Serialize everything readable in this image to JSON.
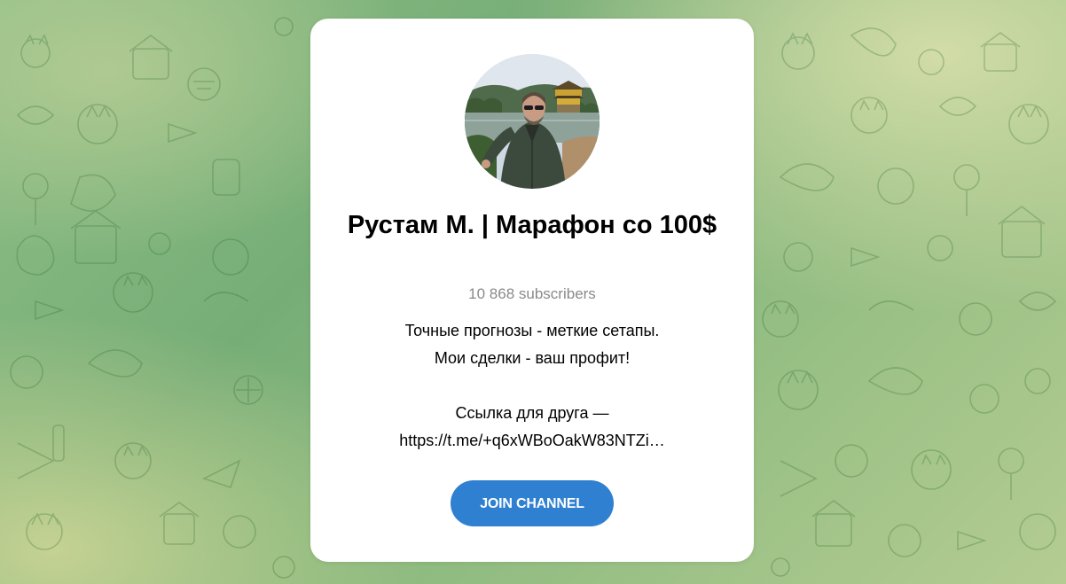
{
  "channel": {
    "title": "Рустам М. | Марафон со 100$",
    "subscribers": "10 868 subscribers",
    "description": {
      "line1": "Точные прогнозы - меткие сетапы.",
      "line2": "Мои сделки - ваш профит!",
      "line3": "Ссылка для друга —",
      "line4": "https://t.me/+q6xWBoOakW83NTZi…"
    },
    "join_label": "JOIN CHANNEL"
  },
  "theme": {
    "accent": "#2f80d0",
    "background": "#8fbf86"
  }
}
